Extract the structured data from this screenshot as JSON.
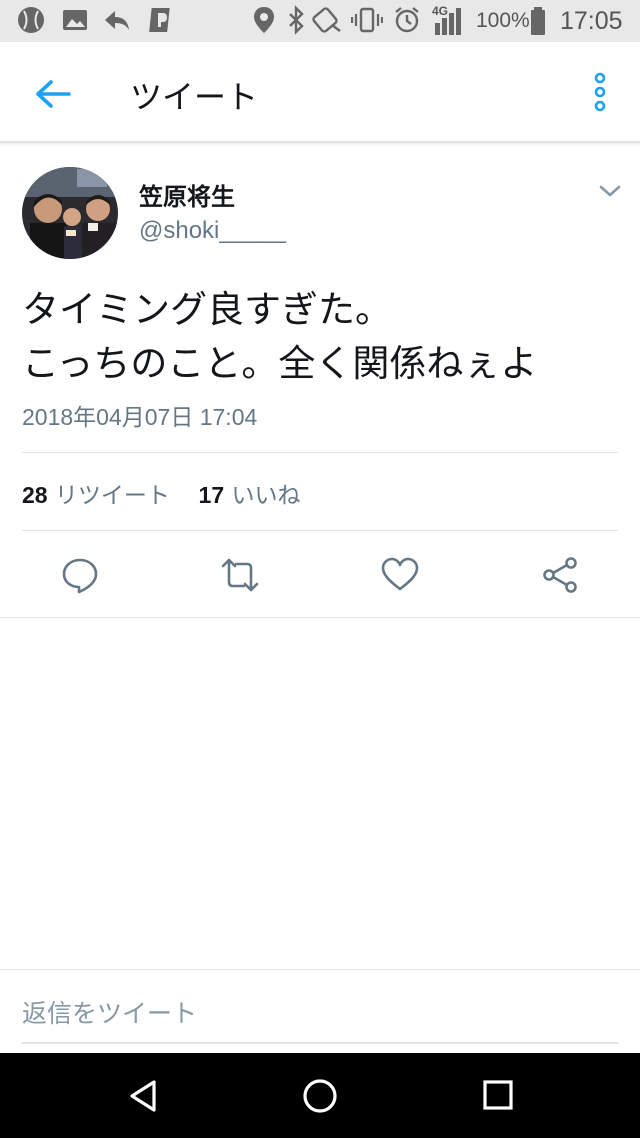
{
  "status_bar": {
    "network": "4G",
    "battery": "100%",
    "time": "17:05"
  },
  "header": {
    "title": "ツイート"
  },
  "tweet": {
    "display_name": "笠原将生",
    "handle": "@shoki_____",
    "text": "タイミング良すぎた。\nこっちのこと。全く関係ねぇよ",
    "timestamp": "2018年04月07日 17:04"
  },
  "stats": {
    "retweets_count": "28",
    "retweets_label": "リツイート",
    "likes_count": "17",
    "likes_label": "いいね"
  },
  "reply": {
    "placeholder": "返信をツイート"
  },
  "colors": {
    "accent": "#1da1f2",
    "secondary_text": "#657786",
    "icon": "#657786"
  },
  "icons": [
    "back-arrow-icon",
    "more-vertical-icon",
    "chevron-down-icon",
    "reply-icon",
    "retweet-icon",
    "like-icon",
    "share-icon",
    "nav-back-icon",
    "nav-home-icon",
    "nav-recents-icon"
  ]
}
